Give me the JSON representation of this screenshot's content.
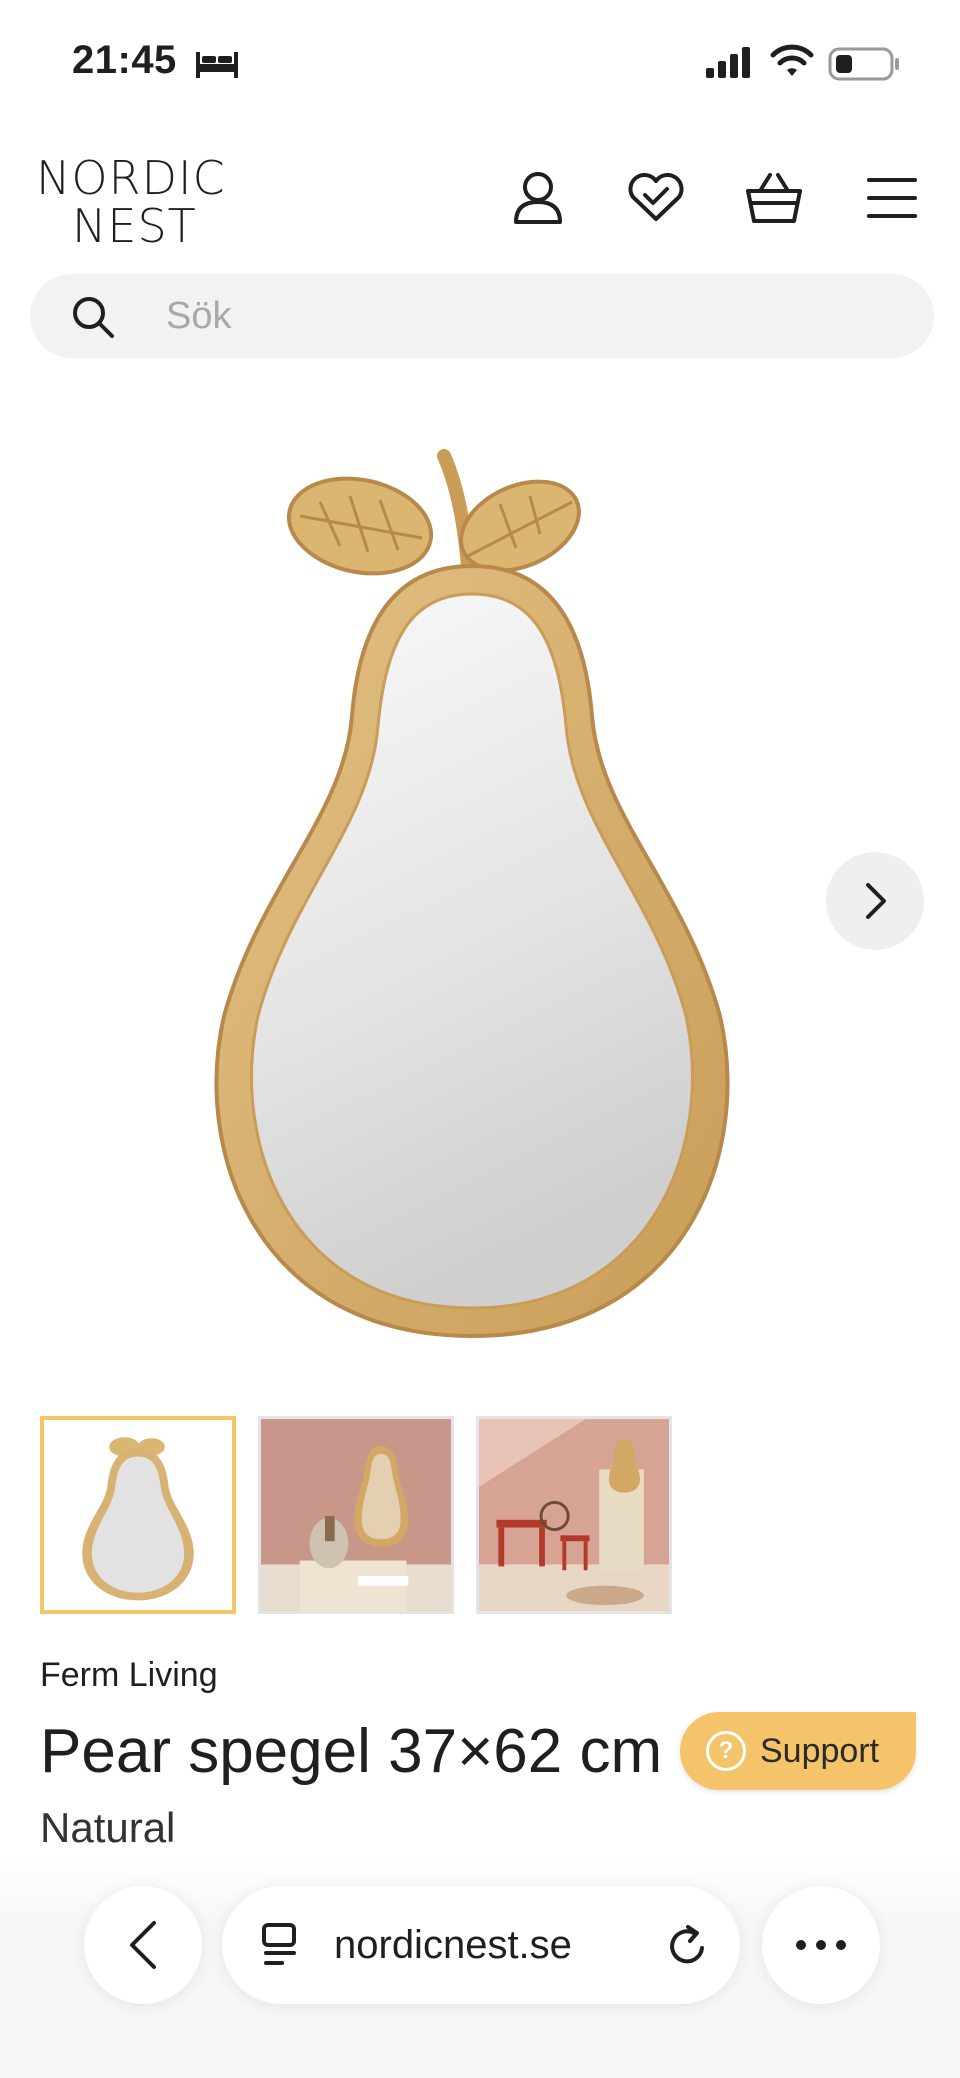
{
  "status_bar": {
    "time": "21:45",
    "icons": [
      "bed-icon",
      "signal-icon",
      "wifi-icon",
      "battery-icon"
    ]
  },
  "header": {
    "logo_line1": "NORDIC",
    "logo_line2": "NEST",
    "icons": [
      "account-icon",
      "wishlist-icon",
      "cart-icon",
      "menu-icon"
    ]
  },
  "search": {
    "placeholder": "Sök"
  },
  "gallery": {
    "thumbnail_count": 3,
    "active_index": 0
  },
  "product": {
    "brand": "Ferm Living",
    "title": "Pear spegel 37×62 cm",
    "variant": "Natural"
  },
  "support": {
    "label": "Support"
  },
  "browser": {
    "url": "nordicnest.se"
  },
  "colors": {
    "accent": "#f5c46a",
    "rattan": "#d8b272",
    "search_bg": "#f2f2f2"
  }
}
